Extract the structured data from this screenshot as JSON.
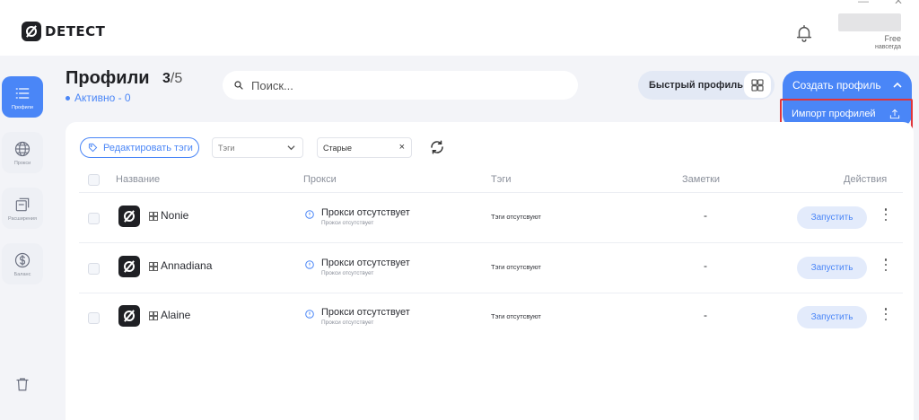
{
  "app": {
    "logo_text": "DETECT"
  },
  "user": {
    "plan": "Free",
    "valid_until": "навсегда"
  },
  "sidebar": {
    "items": [
      {
        "label": "Профили",
        "icon": "list-icon",
        "active": true
      },
      {
        "label": "Прокси",
        "icon": "globe-icon",
        "active": false
      },
      {
        "label": "Расширения",
        "icon": "extensions-icon",
        "active": false
      },
      {
        "label": "Баланс",
        "icon": "dollar-icon",
        "active": false
      }
    ]
  },
  "header": {
    "title": "Профили",
    "count_current": "3",
    "count_limit": "/5",
    "active_label": "Активно - 0"
  },
  "search": {
    "placeholder": "Поиск..."
  },
  "toolbar": {
    "quick_profile_label": "Быстрый профиль",
    "create_profile_label": "Создать профиль",
    "dropdown_import_label": "Импорт профилей"
  },
  "filters": {
    "edit_tags_label": "Редактировать тэги",
    "tags_select_value": "Тэги",
    "sort_select_value": "Старые"
  },
  "table": {
    "columns": [
      "Название",
      "Прокси",
      "Тэги",
      "Заметки",
      "Действия"
    ],
    "rows": [
      {
        "name": "Nonie",
        "proxy_main": "Прокси отсутствует",
        "proxy_sub": "Прокси отсутствует",
        "tags": "Тэги отсутсвуют",
        "notes": "-",
        "action": "Запустить"
      },
      {
        "name": "Annadiana",
        "proxy_main": "Прокси отсутствует",
        "proxy_sub": "Прокси отсутствует",
        "tags": "Тэги отсутсвуют",
        "notes": "-",
        "action": "Запустить"
      },
      {
        "name": "Alaine",
        "proxy_main": "Прокси отсутствует",
        "proxy_sub": "Прокси отсутствует",
        "tags": "Тэги отсутсвуют",
        "notes": "-",
        "action": "Запустить"
      }
    ]
  },
  "colors": {
    "accent": "#4a86f7",
    "highlight": "#e0353a",
    "background": "#f3f4f8"
  }
}
